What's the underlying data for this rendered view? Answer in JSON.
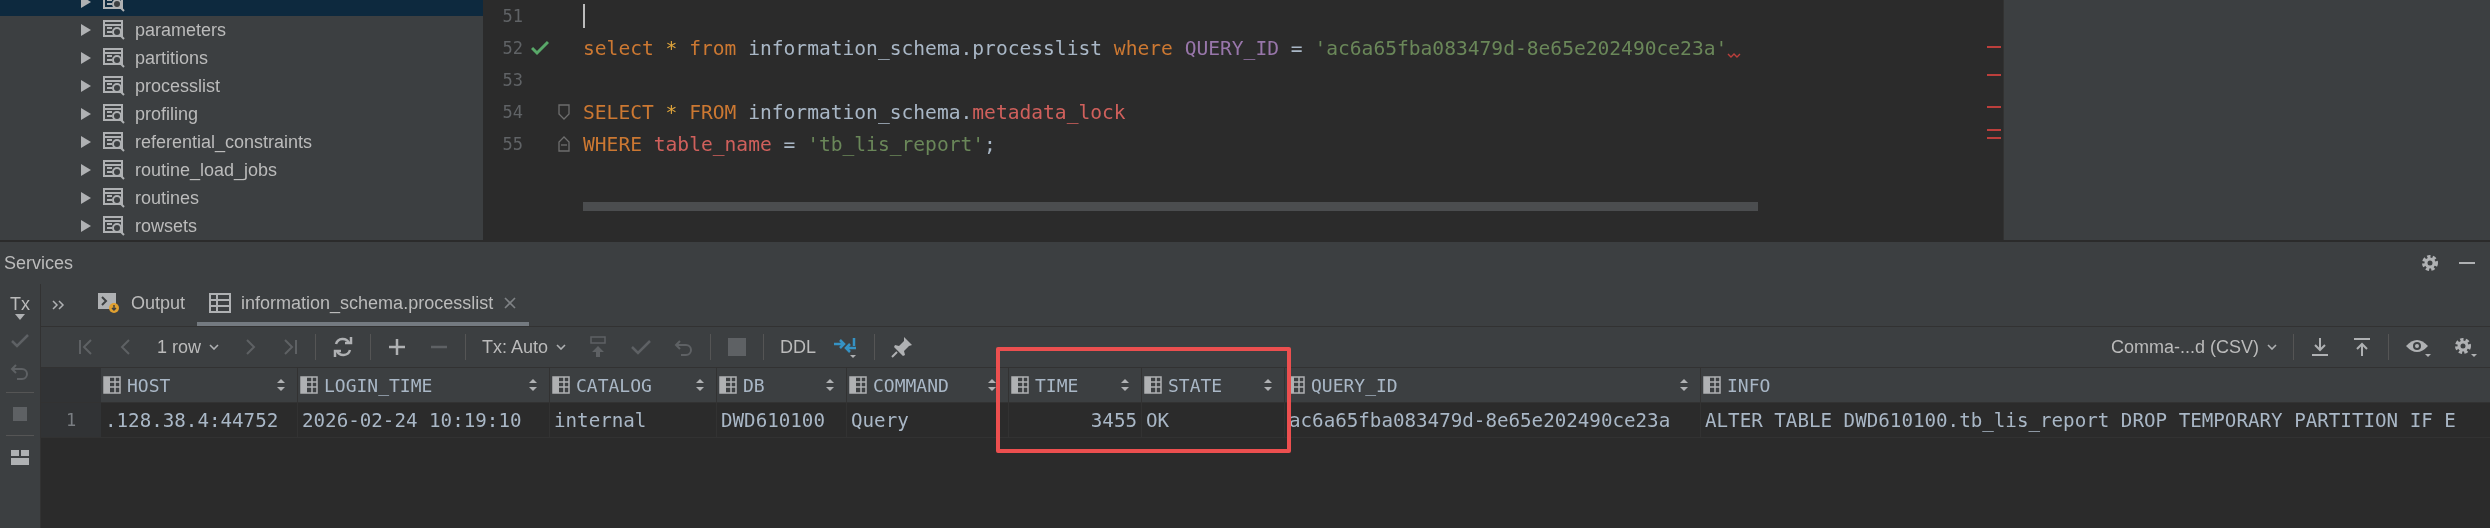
{
  "database_tree": {
    "items": [
      {
        "selected": true,
        "expanded": false
      },
      {
        "label": "parameters",
        "selected": false,
        "expanded": false
      },
      {
        "label": "partitions",
        "selected": false,
        "expanded": false
      },
      {
        "label": "processlist",
        "selected": false,
        "expanded": false
      },
      {
        "label": "profiling",
        "selected": false,
        "expanded": false
      },
      {
        "label": "referential_constraints",
        "selected": false,
        "expanded": false
      },
      {
        "label": "routine_load_jobs",
        "selected": false,
        "expanded": false
      },
      {
        "label": "routines",
        "selected": false,
        "expanded": false
      },
      {
        "label": "rowsets",
        "selected": false,
        "expanded": false
      }
    ]
  },
  "editor": {
    "lines": [
      {
        "number": "51",
        "caret": true,
        "executed": false,
        "fold_start": false,
        "fold_end": false,
        "error": false
      },
      {
        "number": "52",
        "caret": false,
        "executed": true,
        "fold_start": false,
        "fold_end": false,
        "error": true,
        "tokens": [
          {
            "kind": "keyword",
            "text": "select"
          },
          {
            "kind": "operator",
            "text": " * "
          },
          {
            "kind": "keyword",
            "text": "from"
          },
          {
            "kind": "plain",
            "text": " information_schema.processlist "
          },
          {
            "kind": "keyword",
            "text": "where"
          },
          {
            "kind": "column",
            "text": " QUERY_ID"
          },
          {
            "kind": "plain",
            "text": " = "
          },
          {
            "kind": "string",
            "text": "'ac6a65fba083479d-8e65e202490ce23a'"
          }
        ]
      },
      {
        "number": "53",
        "caret": false,
        "executed": false,
        "fold_start": false,
        "fold_end": false,
        "error": false
      },
      {
        "number": "54",
        "caret": false,
        "executed": false,
        "fold_start": true,
        "fold_end": false,
        "error": false,
        "tokens": [
          {
            "kind": "keyword",
            "text": "SELECT"
          },
          {
            "kind": "operator",
            "text": " * "
          },
          {
            "kind": "keyword",
            "text": "FROM"
          },
          {
            "kind": "plain",
            "text": " information_schema."
          },
          {
            "kind": "identifier",
            "text": "metadata_lock"
          }
        ]
      },
      {
        "number": "55",
        "caret": false,
        "executed": false,
        "fold_start": false,
        "fold_end": true,
        "error": false,
        "tokens": [
          {
            "kind": "keyword",
            "text": "WHERE"
          },
          {
            "kind": "identifier",
            "text": " table_name"
          },
          {
            "kind": "plain",
            "text": " = "
          },
          {
            "kind": "string",
            "text": "'tb_lis_report'"
          },
          {
            "kind": "plain",
            "text": ";"
          }
        ]
      }
    ]
  },
  "services": {
    "title": "Services",
    "tx_label": "Tx",
    "tabs": [
      {
        "label": "Output",
        "kind": "output",
        "selected": false
      },
      {
        "label": "information_schema.processlist",
        "kind": "table",
        "selected": true
      }
    ],
    "toolbar": {
      "rows": "1 row",
      "tx_mode": "Tx: Auto",
      "ddl": "DDL",
      "export_format": "Comma-...d (CSV)"
    },
    "table": {
      "columns": [
        {
          "label": "HOST",
          "kind": "text"
        },
        {
          "label": "LOGIN_TIME",
          "kind": "text"
        },
        {
          "label": "CATALOG",
          "kind": "text"
        },
        {
          "label": "DB",
          "kind": "text"
        },
        {
          "label": "COMMAND",
          "kind": "text"
        },
        {
          "label": "TIME",
          "kind": "number"
        },
        {
          "label": "STATE",
          "kind": "text"
        },
        {
          "label": "QUERY_ID",
          "kind": "text"
        },
        {
          "label": "INFO",
          "kind": "text"
        }
      ],
      "rows": [
        {
          "number": "1",
          "cells": [
            ".128.38.4:44752",
            "2026-02-24 10:19:10",
            "internal",
            "DWD610100",
            "Query",
            "3455",
            "OK",
            "ac6a65fba083479d-8e65e202490ce23a",
            "ALTER TABLE DWD610100.tb_lis_report DROP TEMPORARY PARTITION IF E"
          ]
        }
      ]
    }
  }
}
